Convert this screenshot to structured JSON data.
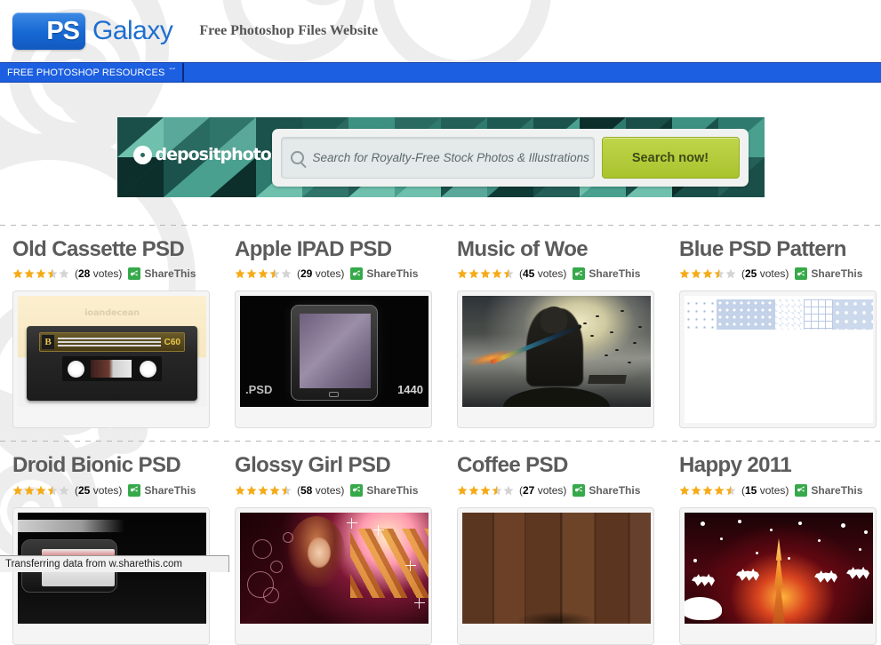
{
  "header": {
    "logo_badge": "PS",
    "logo_word": "Galaxy",
    "tagline": "Free Photoshop Files Website"
  },
  "nav": {
    "main_label": "FREE PHOTOSHOP RESOURCES",
    "chevron": "ˇˇ",
    "bar_color": "#1c5fe0"
  },
  "banner": {
    "brand": "depositphotos",
    "search_placeholder": "Search for Royalty-Free Stock Photos & Illustrations",
    "button_label": "Search now!",
    "button_color": "#b5cc3f",
    "mosaic_color": "#2c6a63"
  },
  "grid": {
    "votes_suffix": "votes",
    "share_label": "ShareThis",
    "rows": [
      [
        {
          "title": "Old Cassette PSD",
          "rating": 3.5,
          "votes": "28",
          "thumb": "cassette",
          "thumb_text": {
            "watermark": "ioandecean",
            "label_b": "B",
            "label_c60": "C60"
          }
        },
        {
          "title": "Apple IPAD PSD",
          "rating": 3.5,
          "votes": "29",
          "thumb": "ipad",
          "thumb_text": {
            "psd": ".PSD",
            "size": "1440"
          }
        },
        {
          "title": "Music of Woe",
          "rating": 4.5,
          "votes": "45",
          "thumb": "woe"
        },
        {
          "title": "Blue PSD Pattern",
          "rating": 3.5,
          "votes": "25",
          "thumb": "bluepattern"
        }
      ],
      [
        {
          "title": "Droid Bionic PSD",
          "rating": 3.5,
          "votes": "25",
          "thumb": "droid"
        },
        {
          "title": "Glossy Girl PSD",
          "rating": 4.5,
          "votes": "58",
          "thumb": "glossygirl"
        },
        {
          "title": "Coffee PSD",
          "rating": 3.5,
          "votes": "27",
          "thumb": "coffee"
        },
        {
          "title": "Happy 2011",
          "rating": 4.5,
          "votes": "15",
          "thumb": "happy2011"
        }
      ]
    ]
  },
  "statusbar": {
    "text": "Transferring data from w.sharethis.com"
  },
  "colors": {
    "star_filled": "#f5ab18",
    "star_empty": "#d4d4d4",
    "share_green": "#36a94a",
    "title_gray": "#5b5b5b",
    "link_blue": "#1f6fd0"
  }
}
